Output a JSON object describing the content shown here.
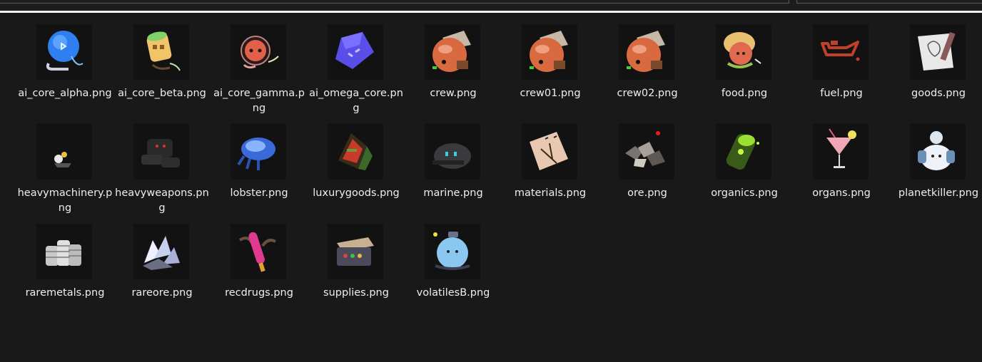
{
  "files": [
    {
      "name": "ai_core_alpha.png",
      "icon": "blue-orb-icon"
    },
    {
      "name": "ai_core_beta.png",
      "icon": "yellow-canister-icon"
    },
    {
      "name": "ai_core_gamma.png",
      "icon": "red-pod-icon"
    },
    {
      "name": "ai_omega_core.png",
      "icon": "purple-crystal-icon"
    },
    {
      "name": "crew.png",
      "icon": "crew-helmet-icon"
    },
    {
      "name": "crew01.png",
      "icon": "crew-helmet-icon"
    },
    {
      "name": "crew02.png",
      "icon": "crew-helmet-icon"
    },
    {
      "name": "food.png",
      "icon": "food-bun-icon"
    },
    {
      "name": "fuel.png",
      "icon": "oil-can-icon"
    },
    {
      "name": "goods.png",
      "icon": "goods-canvas-icon"
    },
    {
      "name": "heavymachinery.png",
      "icon": "machinery-icon"
    },
    {
      "name": "heavyweapons.png",
      "icon": "weapons-icon"
    },
    {
      "name": "lobster.png",
      "icon": "lobster-icon"
    },
    {
      "name": "luxurygoods.png",
      "icon": "sandwich-icon"
    },
    {
      "name": "marine.png",
      "icon": "marine-helmet-icon"
    },
    {
      "name": "materials.png",
      "icon": "materials-board-icon"
    },
    {
      "name": "ore.png",
      "icon": "ore-rocks-icon"
    },
    {
      "name": "organics.png",
      "icon": "organics-can-icon"
    },
    {
      "name": "organs.png",
      "icon": "cocktail-icon"
    },
    {
      "name": "planetkiller.png",
      "icon": "planetkiller-icon"
    },
    {
      "name": "raremetals.png",
      "icon": "coin-stacks-icon"
    },
    {
      "name": "rareore.png",
      "icon": "rare-ore-icon"
    },
    {
      "name": "recdrugs.png",
      "icon": "recdrugs-icon"
    },
    {
      "name": "supplies.png",
      "icon": "supplies-crate-icon"
    },
    {
      "name": "volatilesB.png",
      "icon": "volatiles-blob-icon"
    }
  ]
}
